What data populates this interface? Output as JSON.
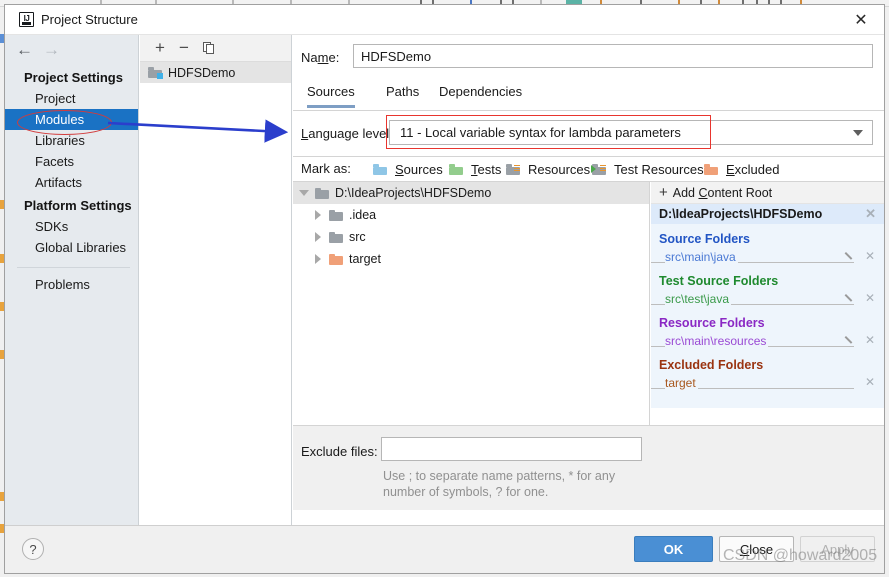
{
  "window": {
    "title": "Project Structure",
    "app_icon": "intellij-idea-icon",
    "close_label": "✕"
  },
  "sidebar": {
    "back_icon": "←",
    "forward_icon": "→",
    "groups": [
      {
        "heading": "Project Settings",
        "items": [
          {
            "label": "Project",
            "selected": false
          },
          {
            "label": "Modules",
            "selected": true
          },
          {
            "label": "Libraries",
            "selected": false
          },
          {
            "label": "Facets",
            "selected": false
          },
          {
            "label": "Artifacts",
            "selected": false
          }
        ]
      },
      {
        "heading": "Platform Settings",
        "items": [
          {
            "label": "SDKs",
            "selected": false
          },
          {
            "label": "Global Libraries",
            "selected": false
          }
        ]
      }
    ],
    "problems_label": "Problems"
  },
  "module_list": {
    "toolbar": {
      "add_label": "+",
      "remove_label": "−",
      "copy_icon": "copy-icon"
    },
    "items": [
      {
        "label": "HDFSDemo",
        "selected": true
      }
    ]
  },
  "main": {
    "name_label_pre": "Na",
    "name_label_mnemonic": "m",
    "name_label_post": "e:",
    "name_value": "HDFSDemo",
    "name_placeholder": "",
    "tabs": [
      {
        "label": "Sources",
        "active": true
      },
      {
        "label": "Paths",
        "active": false
      },
      {
        "label": "Dependencies",
        "active": false
      }
    ],
    "language_level": {
      "label_mnemonic": "L",
      "label_rest": "anguage level:",
      "value": "11 - Local variable syntax for lambda parameters",
      "caret_icon": "chevron-down-icon"
    },
    "mark_as": {
      "label": "Mark as:",
      "options": [
        {
          "mnemonic": "S",
          "rest": "ources",
          "icon": "folder-sources-icon",
          "color": "#8fc6e6"
        },
        {
          "mnemonic": "T",
          "rest": "ests",
          "icon": "folder-tests-icon",
          "color": "#93cd8d"
        },
        {
          "mnemonic": "",
          "rest": "Resources",
          "icon": "folder-resources-icon",
          "color": "#9aa0a6"
        },
        {
          "mnemonic": "",
          "rest": "Test Resources",
          "icon": "folder-test-resources-icon",
          "color": "#9aa0a6"
        },
        {
          "mnemonic": "E",
          "rest": "xcluded",
          "icon": "folder-excluded-icon",
          "color": "#f0a078"
        }
      ]
    },
    "tree": [
      {
        "label": "D:\\IdeaProjects\\HDFSDemo",
        "expanded": true,
        "folder": "gray",
        "level": 0
      },
      {
        "label": ".idea",
        "expanded": false,
        "folder": "gray",
        "level": 1
      },
      {
        "label": "src",
        "expanded": false,
        "folder": "gray",
        "level": 1
      },
      {
        "label": "target",
        "expanded": false,
        "folder": "orange",
        "level": 1
      }
    ],
    "content_roots": {
      "add_button_pre": "Add ",
      "add_button_mnemonic": "C",
      "add_button_post": "ontent Root",
      "plus_icon": "+",
      "root_path": "D:\\IdeaProjects\\HDFSDemo",
      "remove_icon": "✕",
      "groups": [
        {
          "title": "Source Folders",
          "title_color": "#2255c4",
          "value_color": "#4a79d4",
          "entries": [
            {
              "path": "src\\main\\java",
              "has_edit": true,
              "has_remove": true
            }
          ]
        },
        {
          "title": "Test Source Folders",
          "title_color": "#1f8a2f",
          "value_color": "#3a9a4a",
          "entries": [
            {
              "path": "src\\test\\java",
              "has_edit": true,
              "has_remove": true
            }
          ]
        },
        {
          "title": "Resource Folders",
          "title_color": "#8a28c4",
          "value_color": "#9a4ad4",
          "entries": [
            {
              "path": "src\\main\\resources",
              "has_edit": true,
              "has_remove": true
            }
          ]
        },
        {
          "title": "Excluded Folders",
          "title_color": "#9a3310",
          "value_color": "#a8581f",
          "entries": [
            {
              "path": "target",
              "has_edit": false,
              "has_remove": true
            }
          ]
        }
      ]
    },
    "exclude_files": {
      "label": "Exclude files:",
      "value": "",
      "placeholder": "",
      "hint": "Use ; to separate name patterns, * for any number of symbols, ? for one."
    }
  },
  "footer": {
    "help_label": "?",
    "ok_label": "OK",
    "close_pre": "",
    "close_mnemonic": "C",
    "close_post": "lose",
    "apply_label": "Apply",
    "apply_disabled": true
  },
  "annotations": {
    "ellipse_target": "Modules",
    "arrow_from": "Modules",
    "arrow_to": "Language level",
    "red_box_target": "language-level-combobox",
    "watermark": "CSDN @howard2005",
    "annotation_color": "#d23c3c",
    "arrow_color": "#2b3ecc"
  }
}
